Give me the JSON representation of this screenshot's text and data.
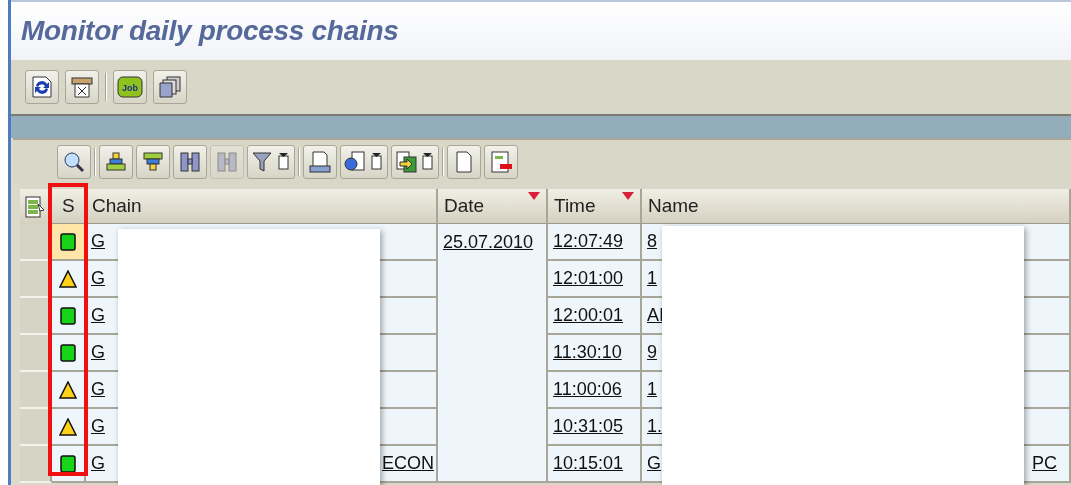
{
  "window": {
    "title": "Monitor daily process chains"
  },
  "app_toolbar": [
    {
      "kind": "refresh"
    },
    {
      "kind": "print"
    },
    {
      "kind": "sep"
    },
    {
      "kind": "job",
      "label": "Job"
    },
    {
      "kind": "copy"
    }
  ],
  "grid_toolbar": [
    {
      "kind": "details",
      "disabled": false
    },
    {
      "kind": "sep"
    },
    {
      "kind": "sort-up",
      "disabled": false
    },
    {
      "kind": "sort-down",
      "disabled": false
    },
    {
      "kind": "find",
      "disabled": false
    },
    {
      "kind": "find-next",
      "disabled": true
    },
    {
      "kind": "filter",
      "disabled": false
    },
    {
      "kind": "sep"
    },
    {
      "kind": "printer",
      "disabled": false
    },
    {
      "kind": "views",
      "disabled": false
    },
    {
      "kind": "export",
      "disabled": false
    },
    {
      "kind": "sep"
    },
    {
      "kind": "document",
      "disabled": false
    },
    {
      "kind": "layout",
      "disabled": false
    }
  ],
  "table": {
    "columns": [
      {
        "label": "S",
        "sorted": false
      },
      {
        "label": "Chain",
        "sorted": false
      },
      {
        "label": "Date",
        "sorted": true
      },
      {
        "label": "Time",
        "sorted": true
      },
      {
        "label": "Name",
        "sorted": false
      }
    ],
    "rows": [
      {
        "kind": "success",
        "selected": true,
        "chain": "G",
        "date": "25.07.2010",
        "time": "12:07:49",
        "name": "8"
      },
      {
        "kind": "warning",
        "selected": false,
        "chain": "G",
        "time": "12:01:00",
        "name": "1"
      },
      {
        "kind": "success",
        "selected": false,
        "chain": "G",
        "time": "12:00:01",
        "name": "AI"
      },
      {
        "kind": "success",
        "selected": false,
        "chain": "G",
        "time": "11:30:10",
        "name": "9"
      },
      {
        "kind": "warning",
        "selected": false,
        "chain": "G",
        "time": "11:00:06",
        "name": "1"
      },
      {
        "kind": "warning",
        "selected": false,
        "chain": "G",
        "time": "10:31:05",
        "name": "1."
      },
      {
        "kind": "success",
        "selected": false,
        "chain": "G",
        "chain_tail": "ECON",
        "time": "10:15:01",
        "name": "G",
        "name_tail": "PC"
      }
    ]
  }
}
